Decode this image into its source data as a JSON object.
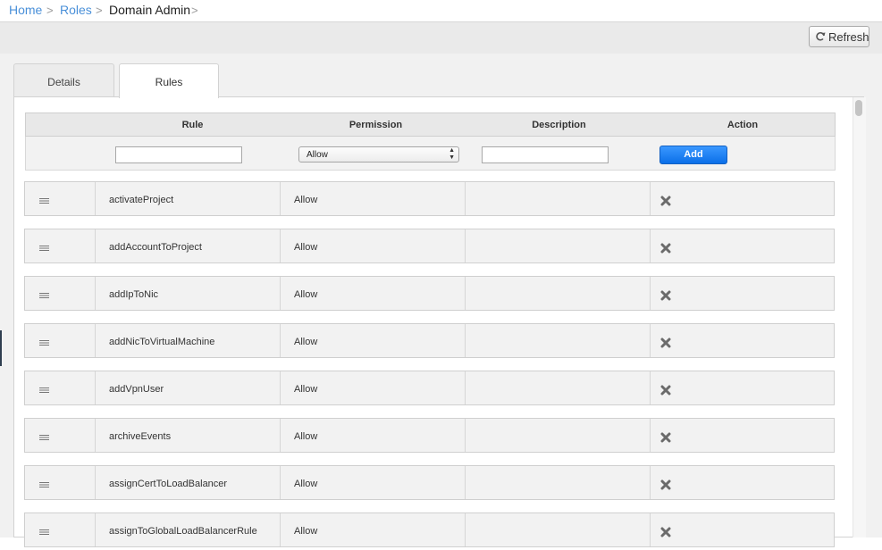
{
  "breadcrumb": {
    "home": "Home",
    "roles": "Roles",
    "current": "Domain Admin",
    "separator": ">"
  },
  "toolbar": {
    "refresh_label": "Refresh",
    "refresh_icon": "refresh-icon"
  },
  "tabs": [
    {
      "label": "Details",
      "active": false
    },
    {
      "label": "Rules",
      "active": true
    }
  ],
  "table": {
    "columns": [
      "Rule",
      "Permission",
      "Description",
      "Action"
    ],
    "new_rule": {
      "rule_value": "",
      "permission_value": "Allow",
      "description_value": "",
      "add_label": "Add"
    },
    "rows": [
      {
        "rule": "activateProject",
        "permission": "Allow",
        "description": ""
      },
      {
        "rule": "addAccountToProject",
        "permission": "Allow",
        "description": ""
      },
      {
        "rule": "addIpToNic",
        "permission": "Allow",
        "description": ""
      },
      {
        "rule": "addNicToVirtualMachine",
        "permission": "Allow",
        "description": ""
      },
      {
        "rule": "addVpnUser",
        "permission": "Allow",
        "description": ""
      },
      {
        "rule": "archiveEvents",
        "permission": "Allow",
        "description": ""
      },
      {
        "rule": "assignCertToLoadBalancer",
        "permission": "Allow",
        "description": ""
      },
      {
        "rule": "assignToGlobalLoadBalancerRule",
        "permission": "Allow",
        "description": ""
      }
    ]
  },
  "colors": {
    "link": "#4a90d9",
    "add_button": "#1a7ff0",
    "delete_icon": "#6b6b6b"
  }
}
